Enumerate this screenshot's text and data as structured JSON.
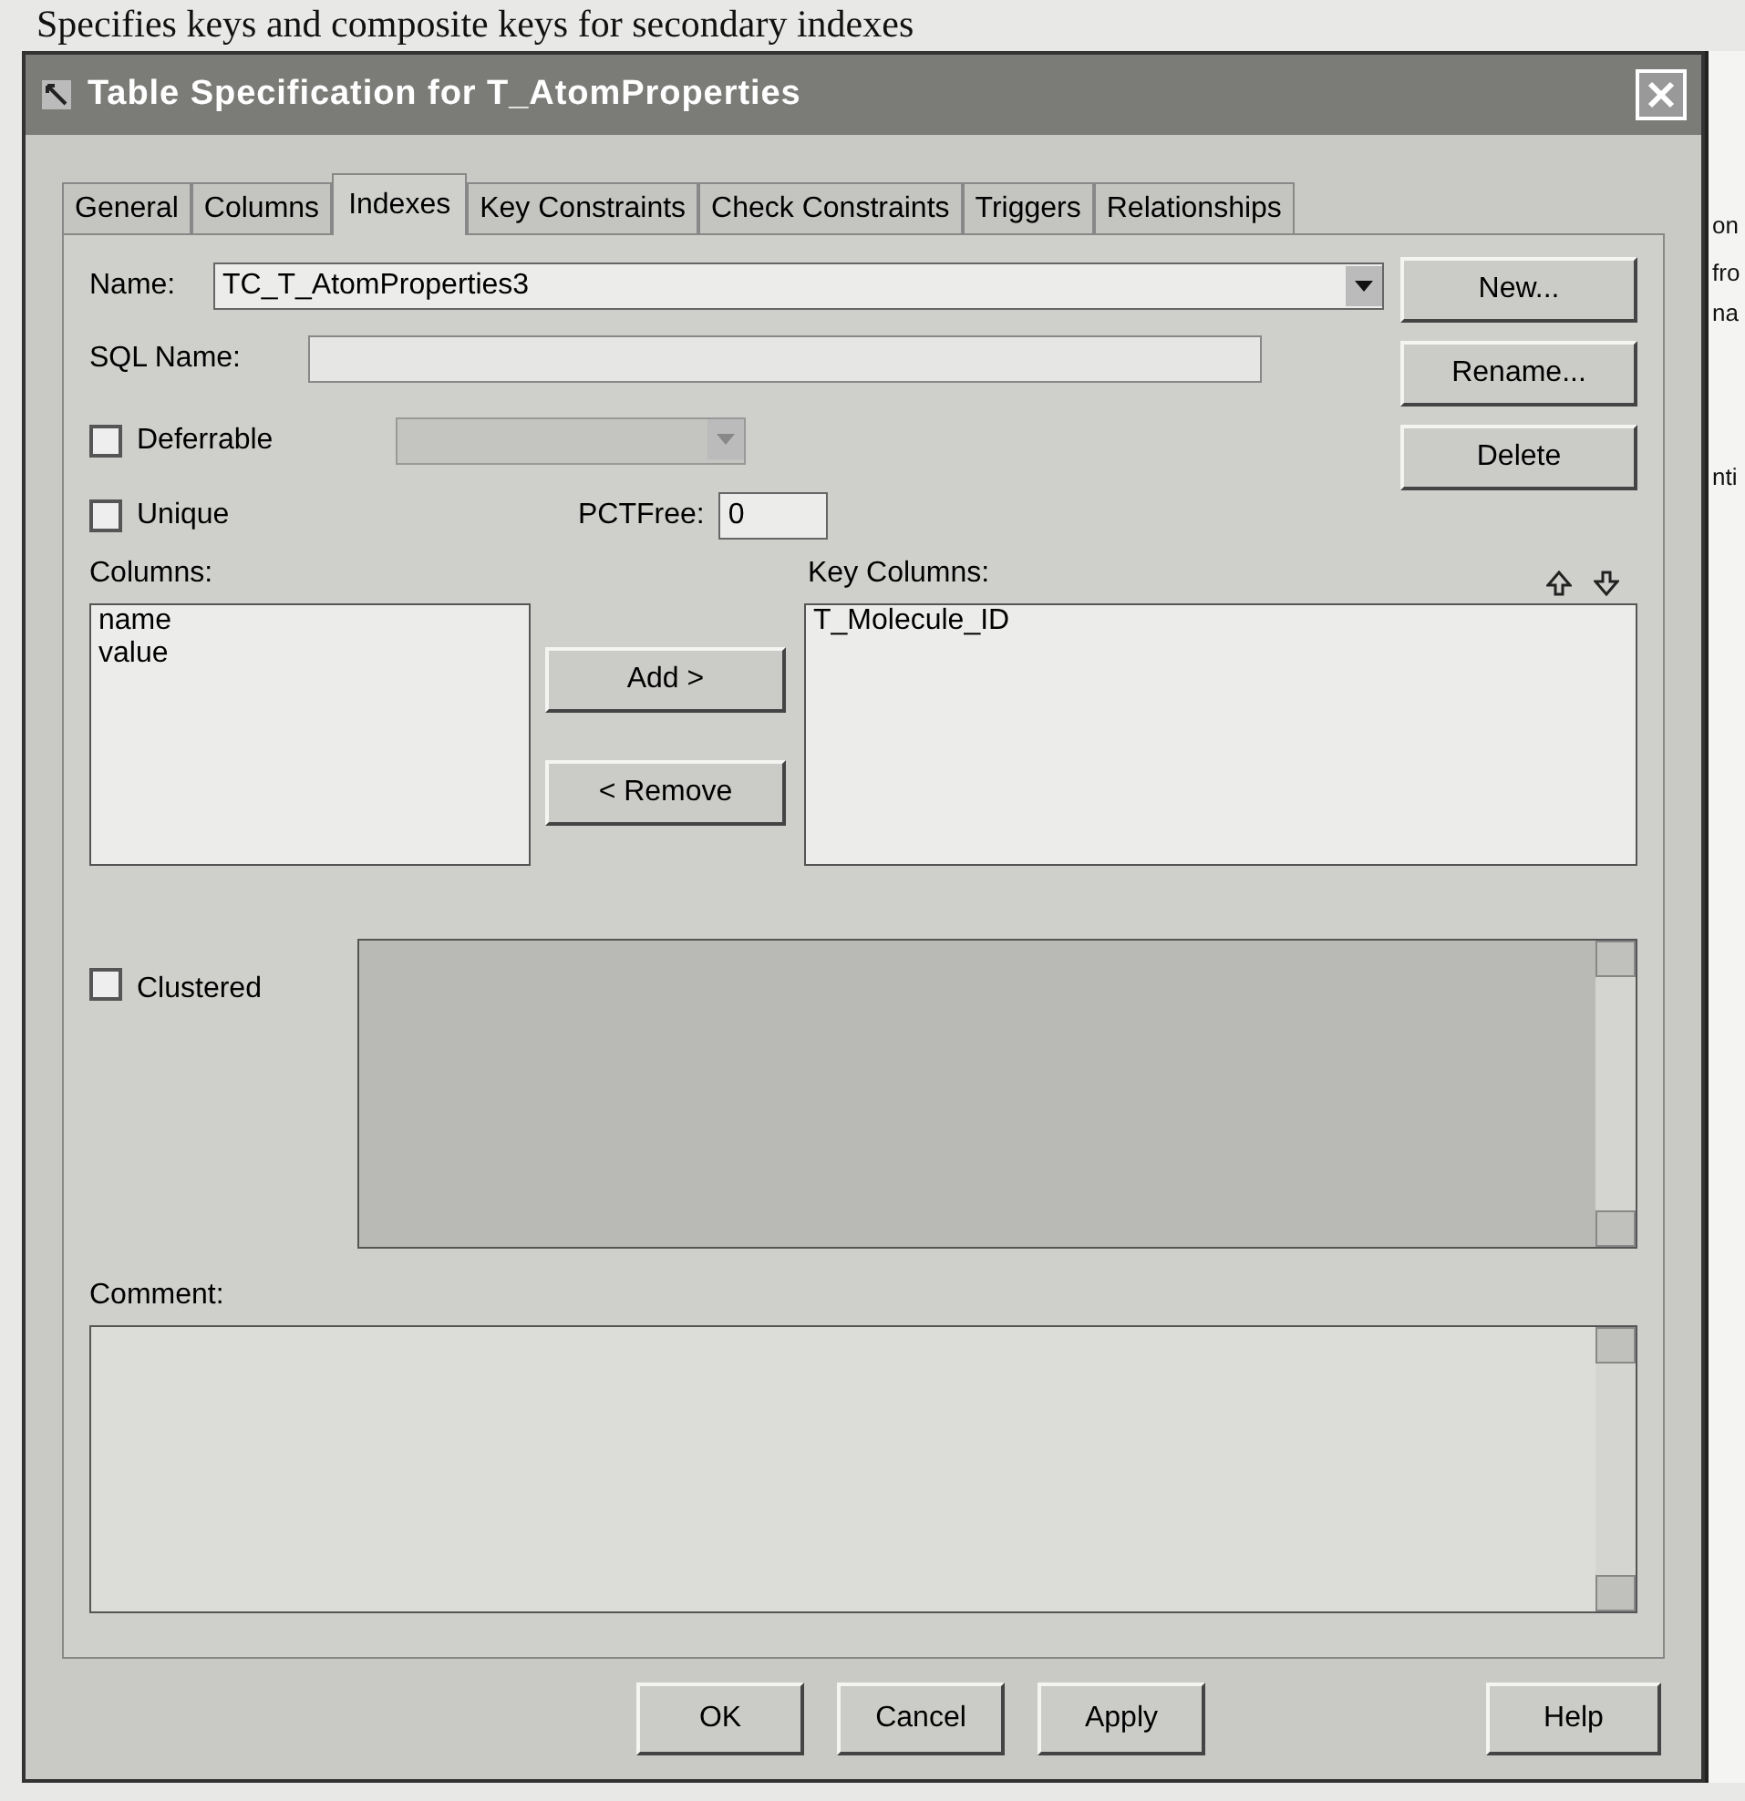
{
  "caption": "Specifies keys and composite keys for secondary indexes",
  "background_window": {
    "fragments": [
      "on",
      "fro",
      "na",
      "nti"
    ]
  },
  "window": {
    "title": "Table Specification for T_AtomProperties"
  },
  "tabs": [
    {
      "label": "General",
      "selected": false
    },
    {
      "label": "Columns",
      "selected": false
    },
    {
      "label": "Indexes",
      "selected": true
    },
    {
      "label": "Key Constraints",
      "selected": false
    },
    {
      "label": "Check Constraints",
      "selected": false
    },
    {
      "label": "Triggers",
      "selected": false
    },
    {
      "label": "Relationships",
      "selected": false
    }
  ],
  "name": {
    "label": "Name:",
    "value": "TC_T_AtomProperties3"
  },
  "sql_name": {
    "label": "SQL Name:"
  },
  "deferrable": {
    "label": "Deferrable",
    "checked": false
  },
  "unique": {
    "label": "Unique",
    "checked": false
  },
  "pctfree": {
    "label": "PCTFree:",
    "value": "0"
  },
  "side_buttons": [
    "New...",
    "Rename...",
    "Delete"
  ],
  "columns": {
    "label": "Columns:",
    "items": [
      "name",
      "value"
    ]
  },
  "move_buttons": [
    "Add >",
    "< Remove"
  ],
  "key_columns": {
    "label": "Key Columns:",
    "items": [
      "T_Molecule_ID"
    ]
  },
  "clustered": {
    "label": "Clustered",
    "checked": false
  },
  "comment": {
    "label": "Comment:"
  },
  "footer_buttons": [
    "OK",
    "Cancel",
    "Apply",
    "Help"
  ]
}
